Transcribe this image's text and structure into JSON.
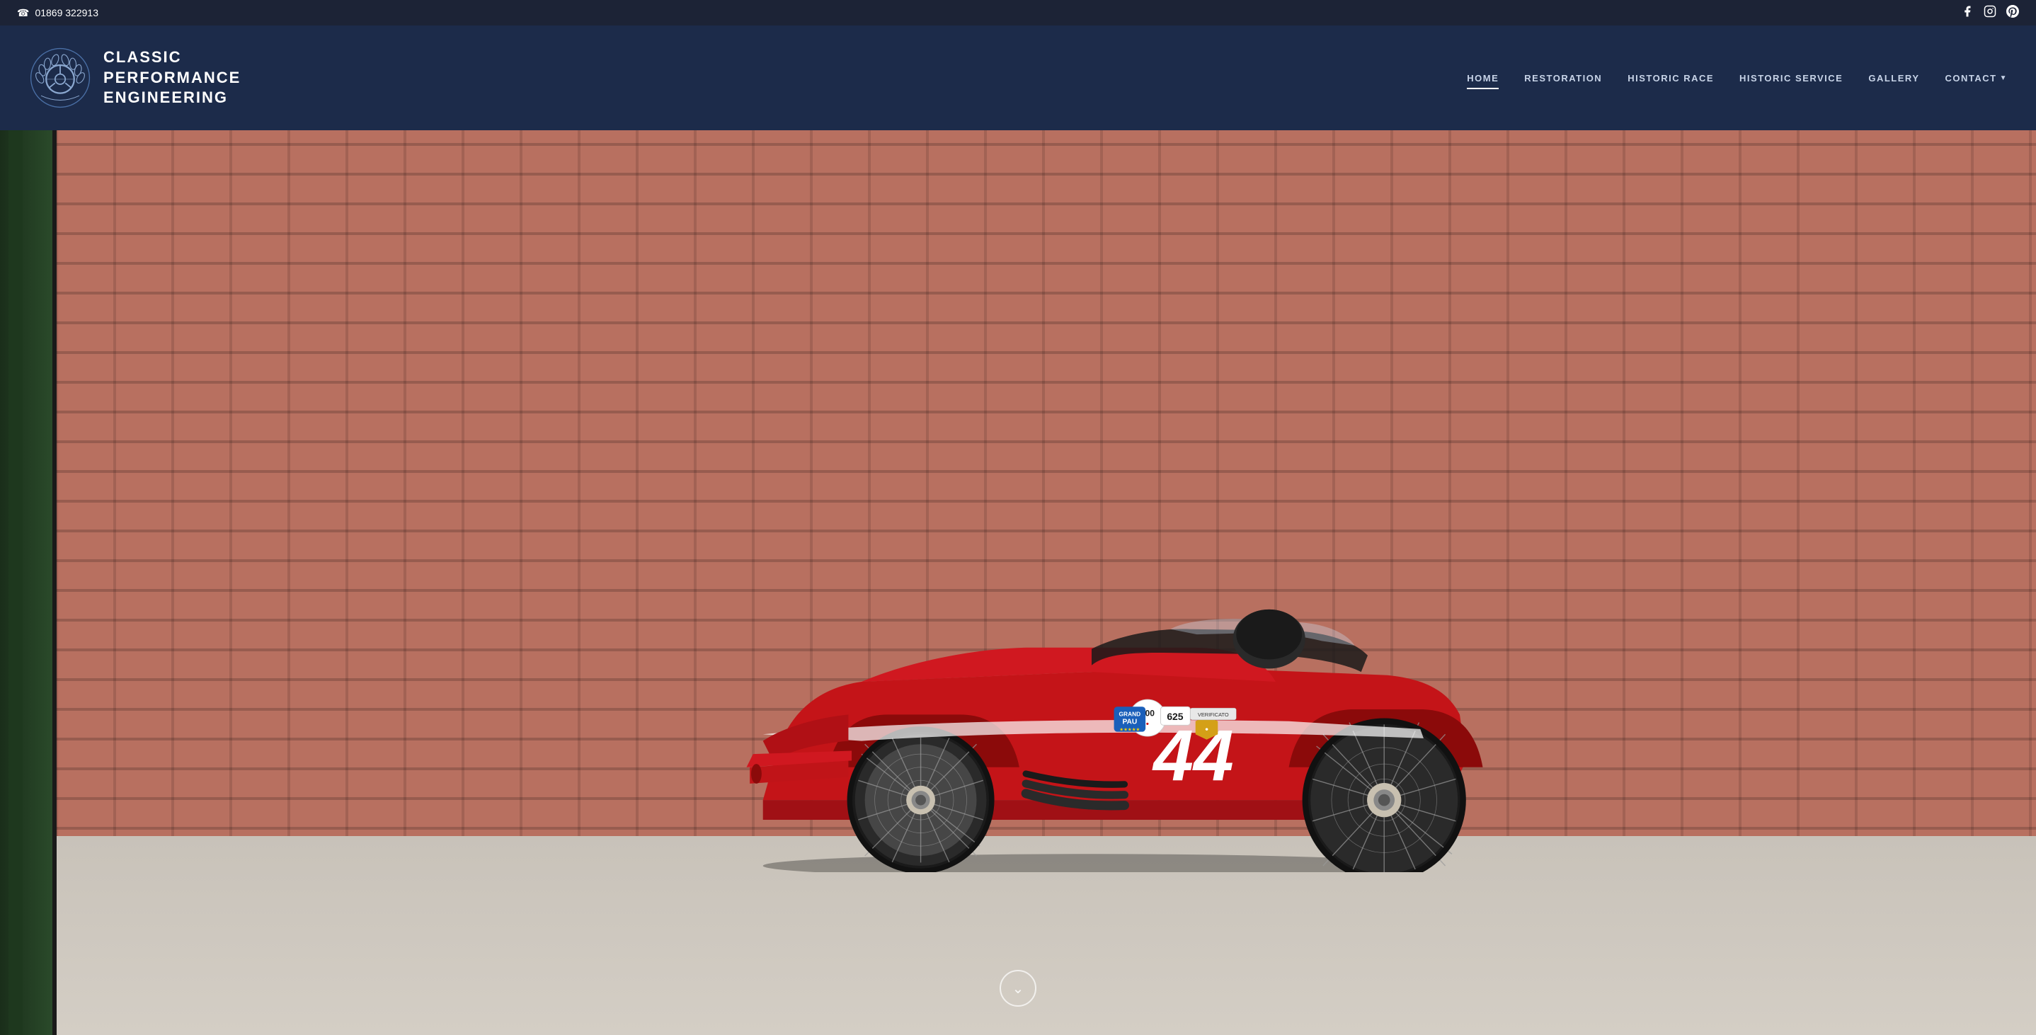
{
  "topbar": {
    "phone": "01869 322913",
    "social": [
      {
        "name": "facebook",
        "symbol": "f"
      },
      {
        "name": "instagram",
        "symbol": "◻"
      },
      {
        "name": "pinterest",
        "symbol": "P"
      }
    ]
  },
  "header": {
    "logo": {
      "line1": "CLASSIC",
      "line2": "PERFORMANCE",
      "line3": "ENGINEERING"
    },
    "nav": [
      {
        "label": "HOME",
        "active": true
      },
      {
        "label": "RESTORATION",
        "active": false
      },
      {
        "label": "HISTORIC RACE",
        "active": false
      },
      {
        "label": "HISTORIC SERVICE",
        "active": false
      },
      {
        "label": "GALLERY",
        "active": false
      },
      {
        "label": "CONTACT",
        "active": false,
        "hasDropdown": true
      }
    ]
  },
  "hero": {
    "car_number": "44",
    "scroll_down_label": "↓",
    "alt_text": "Classic red racing car number 44 in a garage"
  },
  "colors": {
    "nav_bg": "#1c2b4a",
    "topbar_bg": "#1c2336",
    "car_red": "#c0151a",
    "car_dark_red": "#8b0a0a",
    "brick_bg": "#b87060",
    "floor_color": "#cac4bb"
  }
}
